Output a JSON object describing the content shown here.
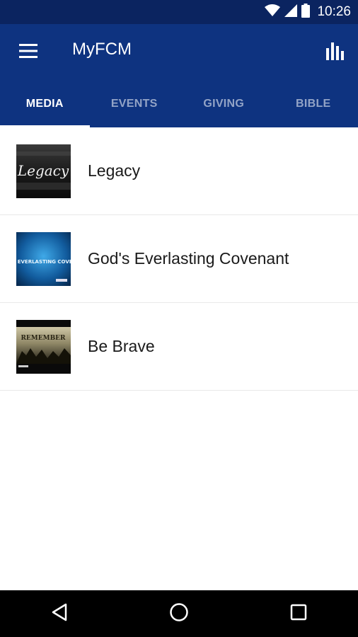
{
  "status_bar": {
    "time": "10:26",
    "icons": [
      "wifi-icon",
      "signal-icon",
      "battery-icon"
    ]
  },
  "app_bar": {
    "title": "MyFCM",
    "menu_icon": "hamburger-menu-icon",
    "action_icon": "bar-chart-icon"
  },
  "tabs": [
    {
      "label": "MEDIA",
      "active": true
    },
    {
      "label": "EVENTS",
      "active": false
    },
    {
      "label": "GIVING",
      "active": false
    },
    {
      "label": "BIBLE",
      "active": false
    }
  ],
  "media_items": [
    {
      "title": "Legacy",
      "thumbnail_text": "Legacy"
    },
    {
      "title": "God's Everlasting Covenant",
      "thumbnail_text": "GOD'S EVERLASTING COVENANT"
    },
    {
      "title": "Be Brave",
      "thumbnail_text": "REMEMBER"
    }
  ],
  "nav_bar": {
    "icons": [
      "back-icon",
      "home-icon",
      "recents-icon"
    ]
  },
  "colors": {
    "status_bar": "#0b2460",
    "app_bar": "#0e3380",
    "tab_indicator": "#ffffff",
    "nav_bar": "#000000"
  }
}
